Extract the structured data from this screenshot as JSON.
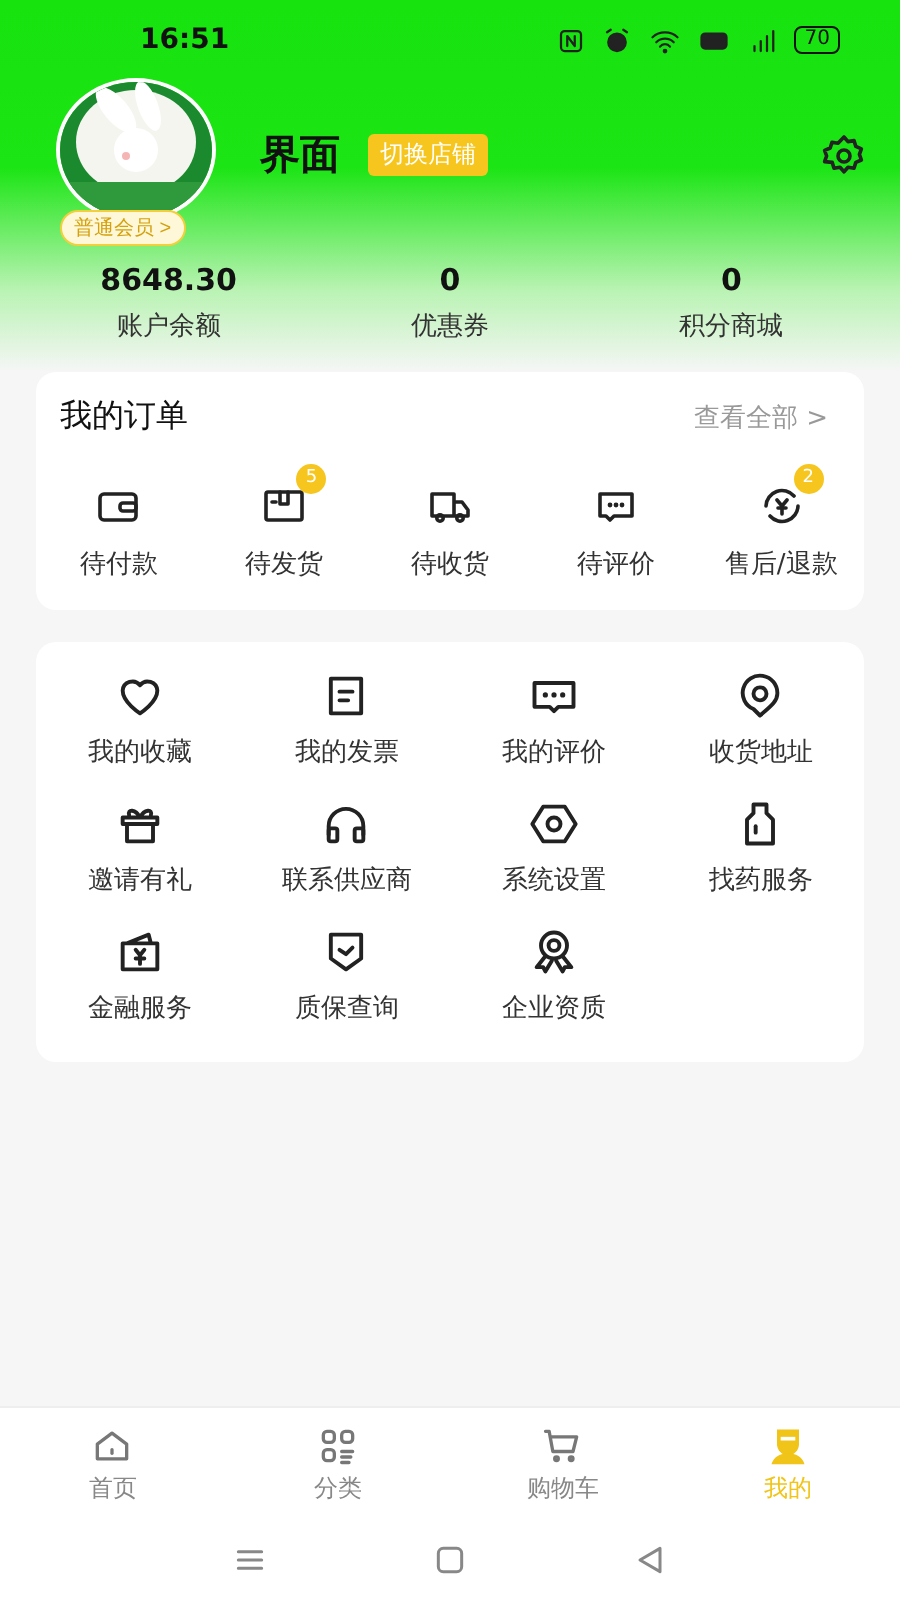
{
  "status_bar": {
    "time": "16:51",
    "battery": "70"
  },
  "profile": {
    "name": "界面",
    "switch_button": "切换店铺",
    "member_level": "普通会员 >"
  },
  "stats": [
    {
      "value": "8648.30",
      "label": "账户余额"
    },
    {
      "value": "0",
      "label": "优惠券"
    },
    {
      "value": "0",
      "label": "积分商城"
    }
  ],
  "orders": {
    "title": "我的订单",
    "view_all": "查看全部 >",
    "items": [
      {
        "label": "待付款"
      },
      {
        "label": "待发货",
        "badge": "5"
      },
      {
        "label": "待收货"
      },
      {
        "label": "待评价"
      },
      {
        "label": "售后/退款",
        "badge": "2"
      }
    ]
  },
  "services": [
    {
      "label": "我的收藏"
    },
    {
      "label": "我的发票"
    },
    {
      "label": "我的评价"
    },
    {
      "label": "收货地址"
    },
    {
      "label": "邀请有礼"
    },
    {
      "label": "联系供应商"
    },
    {
      "label": "系统设置"
    },
    {
      "label": "找药服务"
    },
    {
      "label": "金融服务"
    },
    {
      "label": "质保查询"
    },
    {
      "label": "企业资质"
    }
  ],
  "tab_bar": [
    {
      "label": "首页",
      "selected": false
    },
    {
      "label": "分类",
      "selected": false
    },
    {
      "label": "购物车",
      "selected": false
    },
    {
      "label": "我的",
      "selected": true
    }
  ]
}
